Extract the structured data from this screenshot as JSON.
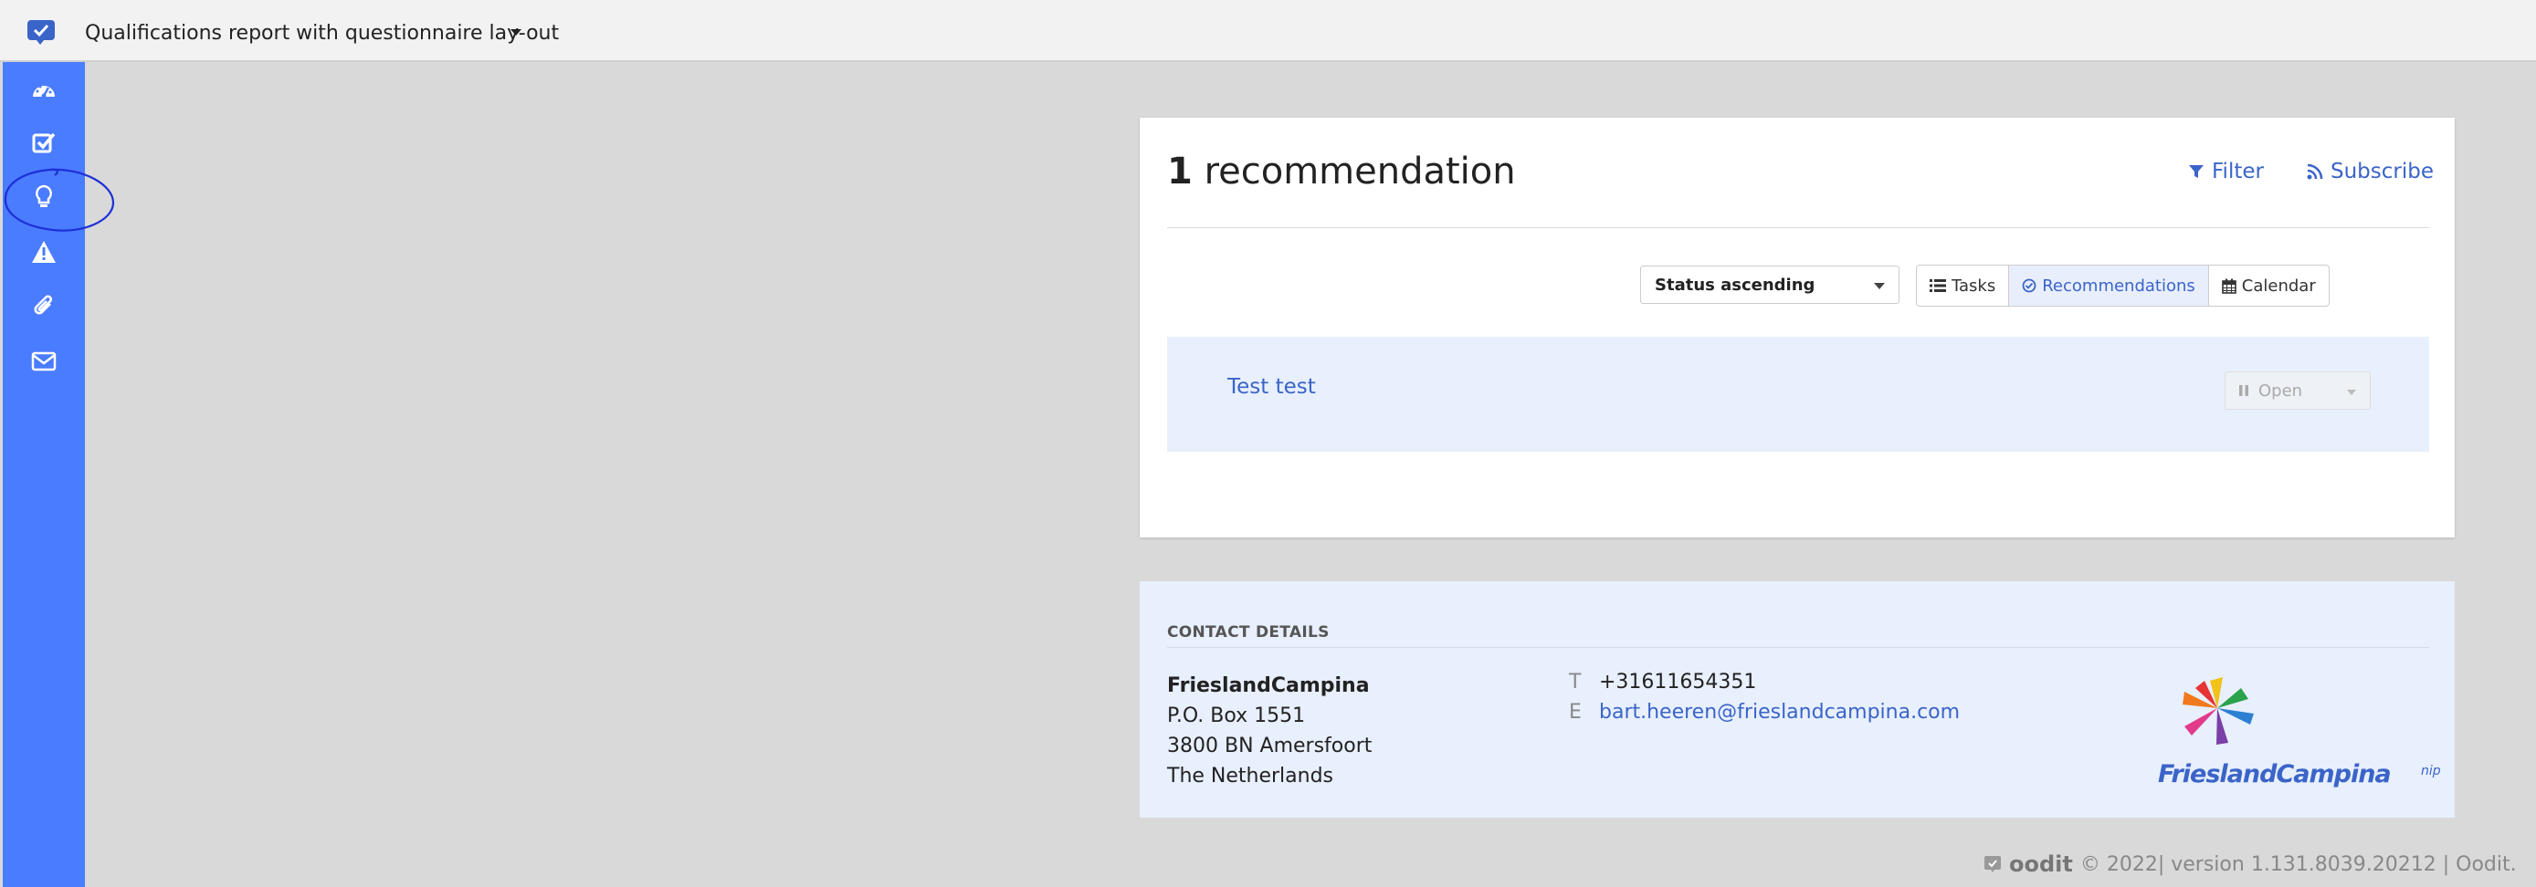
{
  "header": {
    "report_title": "Qualifications report with questionnaire lay-out"
  },
  "sidebar": {
    "items": [
      {
        "name": "dashboard-icon"
      },
      {
        "name": "checkbox-icon"
      },
      {
        "name": "lightbulb-icon",
        "highlighted": true
      },
      {
        "name": "warning-icon"
      },
      {
        "name": "paperclip-icon"
      },
      {
        "name": "envelope-icon"
      }
    ]
  },
  "main": {
    "count": "1",
    "count_label": "recommendation",
    "filter_label": "Filter",
    "subscribe_label": "Subscribe",
    "sort": {
      "selected": "Status ascending"
    },
    "views": {
      "tasks": "Tasks",
      "recommendations": "Recommendations",
      "calendar": "Calendar",
      "active": "recommendations"
    },
    "recommendation": {
      "title": "Test test",
      "status": "Open"
    }
  },
  "contact": {
    "heading": "CONTACT DETAILS",
    "company": "FrieslandCampina",
    "address_line1": "P.O. Box 1551",
    "address_line2": "3800 BN Amersfoort",
    "address_line3": "The Netherlands",
    "phone_label": "T",
    "phone": "+31611654351",
    "email_label": "E",
    "email": "bart.heeren@frieslandcampina.com",
    "logo_text": "FrieslandCampina",
    "logo_suffix": "nip"
  },
  "footer": {
    "brand": "oodit",
    "text": "© 2022| version 1.131.8039.20212 | Oodit."
  },
  "colors": {
    "sidebar": "#4a7cff",
    "link": "#3a64c8",
    "row_highlight": "#e8effd"
  }
}
